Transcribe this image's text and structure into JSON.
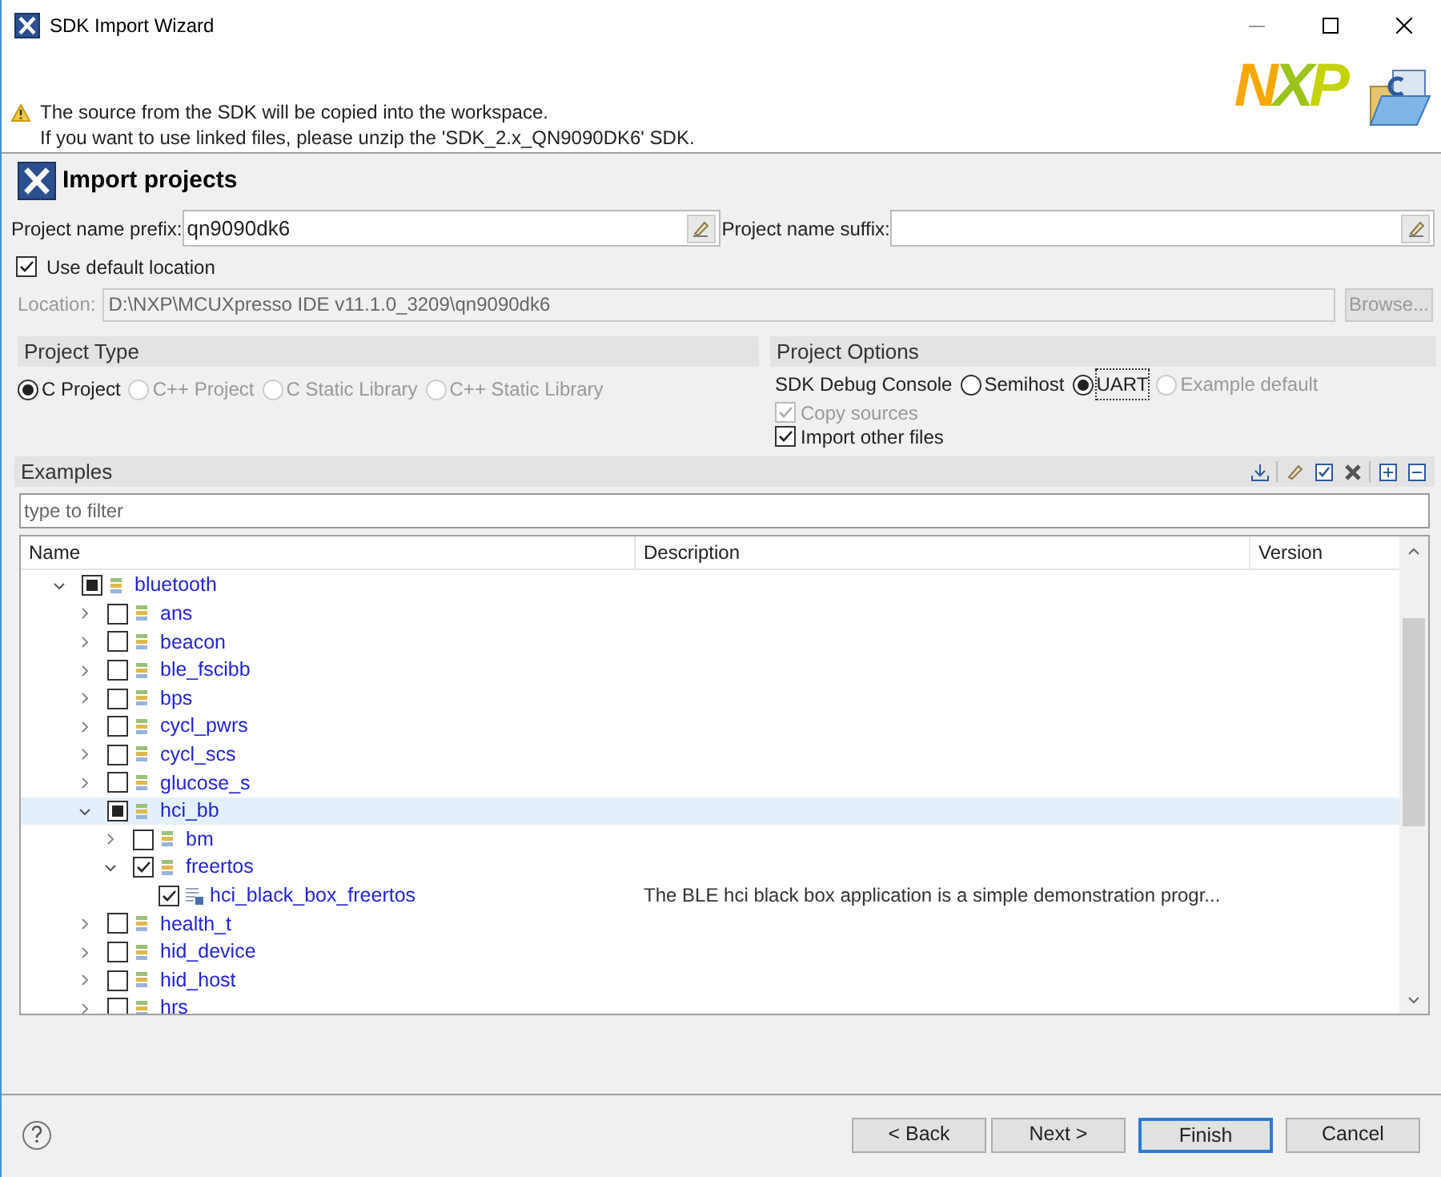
{
  "window": {
    "title": "SDK Import Wizard"
  },
  "header": {
    "logo": "NXP",
    "message_lines": [
      "The source from the SDK will be copied into the workspace.",
      "If you want to use linked files, please unzip the 'SDK_2.x_QN9090DK6' SDK."
    ]
  },
  "page_title": "Import projects",
  "prefix": {
    "label": "Project name prefix:",
    "value": "qn9090dk6"
  },
  "suffix": {
    "label": "Project name suffix:"
  },
  "use_default_location": {
    "label": "Use default location",
    "checked": true
  },
  "location": {
    "label": "Location:",
    "value": "D:\\NXP\\MCUXpresso IDE v11.1.0_3209\\qn9090dk6",
    "disabled": true,
    "browse": "Browse..."
  },
  "project_type": {
    "title": "Project Type",
    "options": [
      {
        "label": "C Project",
        "selected": true,
        "disabled": false
      },
      {
        "label": "C++ Project",
        "selected": false,
        "disabled": true
      },
      {
        "label": "C Static Library",
        "selected": false,
        "disabled": true
      },
      {
        "label": "C++ Static Library",
        "selected": false,
        "disabled": true
      }
    ]
  },
  "project_options": {
    "title": "Project Options",
    "console_label": "SDK Debug Console",
    "console_options": [
      {
        "label": "Semihost",
        "selected": false,
        "disabled": false,
        "focused": false
      },
      {
        "label": "UART",
        "selected": true,
        "disabled": false,
        "focused": true
      },
      {
        "label": "Example default",
        "selected": false,
        "disabled": true,
        "focused": false
      }
    ],
    "checkboxes": [
      {
        "label": "Copy sources",
        "checked": true,
        "disabled": true
      },
      {
        "label": "Import other files",
        "checked": true,
        "disabled": false
      }
    ]
  },
  "examples": {
    "title": "Examples",
    "filter_placeholder": "type to filter",
    "columns": [
      "Name",
      "Description",
      "Version"
    ],
    "tree": [
      {
        "kind": "group",
        "label": "bluetooth",
        "expanded": true,
        "checked": false,
        "mixed": true,
        "selected": false,
        "children": [
          {
            "kind": "group",
            "label": "ans",
            "expanded": false,
            "checked": false,
            "mixed": false,
            "selected": false
          },
          {
            "kind": "group",
            "label": "beacon",
            "expanded": false,
            "checked": false,
            "mixed": false,
            "selected": false
          },
          {
            "kind": "group",
            "label": "ble_fscibb",
            "expanded": false,
            "checked": false,
            "mixed": false,
            "selected": false
          },
          {
            "kind": "group",
            "label": "bps",
            "expanded": false,
            "checked": false,
            "mixed": false,
            "selected": false
          },
          {
            "kind": "group",
            "label": "cycl_pwrs",
            "expanded": false,
            "checked": false,
            "mixed": false,
            "selected": false
          },
          {
            "kind": "group",
            "label": "cycl_scs",
            "expanded": false,
            "checked": false,
            "mixed": false,
            "selected": false
          },
          {
            "kind": "group",
            "label": "glucose_s",
            "expanded": false,
            "checked": false,
            "mixed": false,
            "selected": false
          },
          {
            "kind": "group",
            "label": "hci_bb",
            "expanded": true,
            "checked": false,
            "mixed": true,
            "selected": true,
            "children": [
              {
                "kind": "group",
                "label": "bm",
                "expanded": false,
                "checked": false,
                "mixed": false,
                "selected": false
              },
              {
                "kind": "group",
                "label": "freertos",
                "expanded": true,
                "checked": true,
                "mixed": false,
                "selected": false,
                "children": [
                  {
                    "kind": "project",
                    "label": "hci_black_box_freertos",
                    "description": "The BLE hci black box application is a simple demonstration progr...",
                    "checked": true,
                    "mixed": false,
                    "selected": false
                  }
                ]
              }
            ]
          },
          {
            "kind": "group",
            "label": "health_t",
            "expanded": false,
            "checked": false,
            "mixed": false,
            "selected": false
          },
          {
            "kind": "group",
            "label": "hid_device",
            "expanded": false,
            "checked": false,
            "mixed": false,
            "selected": false
          },
          {
            "kind": "group",
            "label": "hid_host",
            "expanded": false,
            "checked": false,
            "mixed": false,
            "selected": false
          },
          {
            "kind": "group",
            "label": "hrs",
            "expanded": false,
            "checked": false,
            "mixed": false,
            "selected": false
          }
        ]
      }
    ]
  },
  "buttons": [
    {
      "label": "< Back",
      "default": false
    },
    {
      "label": "Next >",
      "default": false
    },
    {
      "label": "Finish",
      "default": true
    },
    {
      "label": "Cancel",
      "default": false
    }
  ]
}
